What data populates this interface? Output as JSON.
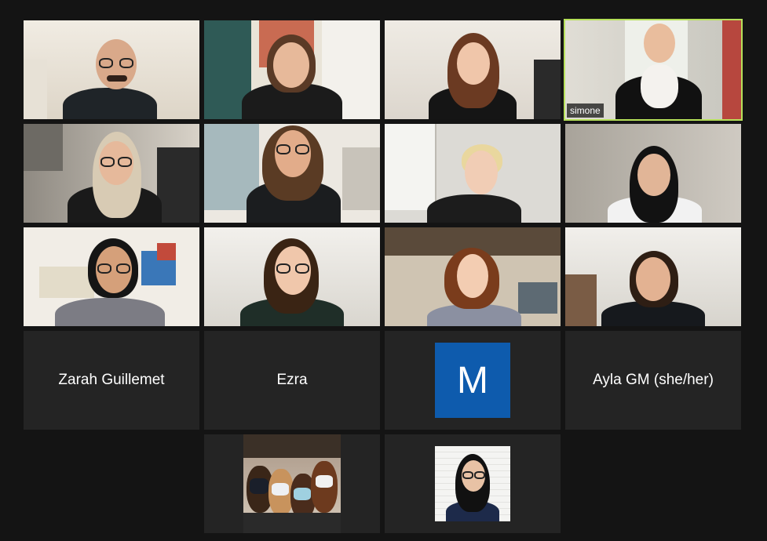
{
  "meeting": {
    "participants": [
      {
        "id": "p1",
        "type": "video",
        "bg": "#e9e3d8",
        "skin": "#d9a98a",
        "hair": "#4a3a30",
        "shirt": "#1f2428"
      },
      {
        "id": "p2",
        "type": "video",
        "bg": "#d6d0c2",
        "skin": "#e7b99a",
        "hair": "#5a3a26",
        "shirt": "#1b1b1b"
      },
      {
        "id": "p3",
        "type": "video",
        "bg": "#e8e4dc",
        "skin": "#f0c6aa",
        "hair": "#6b3a22",
        "shirt": "#151515"
      },
      {
        "id": "p4",
        "type": "video",
        "bg": "#d7d7d0",
        "skin": "#e9bd9d",
        "hair": "#7a5a3a",
        "shirt": "#111111",
        "label": "simone",
        "active": true
      },
      {
        "id": "p5",
        "type": "video",
        "bg": "#c9c2b5",
        "skin": "#e6b99b",
        "hair": "#d8cbb4",
        "shirt": "#1a1a1a"
      },
      {
        "id": "p6",
        "type": "video",
        "bg": "#e2ddd4",
        "skin": "#e2ac8a",
        "hair": "#5a3b24",
        "shirt": "#1b1d1f"
      },
      {
        "id": "p7",
        "type": "video",
        "bg": "#d8d6d2",
        "skin": "#f1cdb5",
        "hair": "#e9d79e",
        "shirt": "#1c1c1c"
      },
      {
        "id": "p8",
        "type": "video",
        "bg": "#bdb7af",
        "skin": "#e1b597",
        "hair": "#121212",
        "shirt": "#f2f2f2"
      },
      {
        "id": "p9",
        "type": "video",
        "bg": "#efeae2",
        "skin": "#d5a07a",
        "hair": "#151515",
        "shirt": "#7c7c84"
      },
      {
        "id": "p10",
        "type": "video",
        "bg": "#ebe8e2",
        "skin": "#f0c7ab",
        "hair": "#3a2414",
        "shirt": "#1f2e28"
      },
      {
        "id": "p11",
        "type": "video",
        "bg": "#d3c8b6",
        "skin": "#f3cdb2",
        "hair": "#7a3c1c",
        "shirt": "#8b90a1"
      },
      {
        "id": "p12",
        "type": "video",
        "bg": "#e7e5e1",
        "skin": "#e3b292",
        "hair": "#2e1e14",
        "shirt": "#16191d"
      },
      {
        "id": "p13",
        "type": "name",
        "name": "Zarah Guillemet"
      },
      {
        "id": "p14",
        "type": "name",
        "name": "Ezra"
      },
      {
        "id": "p15",
        "type": "initial",
        "initial": "M",
        "color": "#0e5bad"
      },
      {
        "id": "p16",
        "type": "name",
        "name": "Ayla GM (she/her)"
      },
      {
        "id": "p17",
        "type": "photo-group"
      },
      {
        "id": "p18",
        "type": "photo-portrait"
      }
    ]
  },
  "labels": {
    "simone": "simone",
    "zarah": "Zarah Guillemet",
    "ezra": "Ezra",
    "m_initial": "M",
    "ayla": "Ayla GM (she/her)"
  },
  "colors": {
    "window_bg": "#141414",
    "tile_bg": "#242424",
    "active_border": "#b6e05a",
    "avatar_blue": "#0e5bad"
  }
}
